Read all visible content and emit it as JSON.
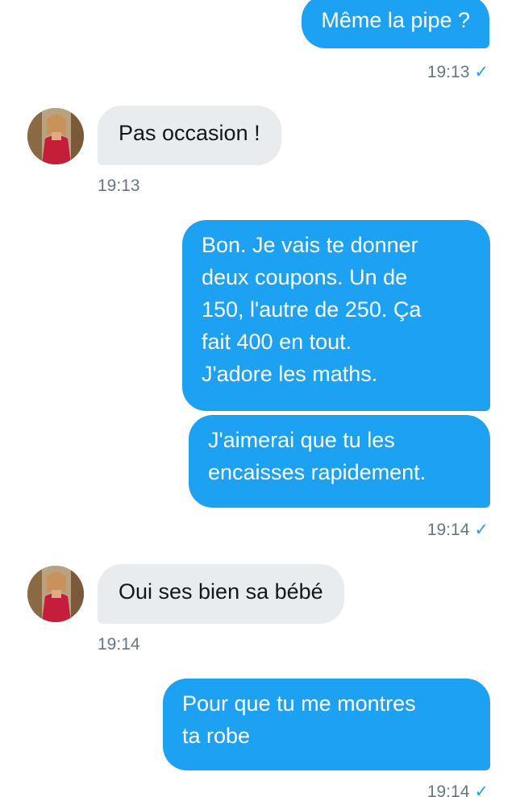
{
  "messages": [
    {
      "text": "Même la pipe ?",
      "time": "19:13"
    },
    {
      "text": "Pas occasion !",
      "time": "19:13"
    },
    {
      "lines": [
        "Bon. Je vais te donner",
        "deux coupons. Un de",
        "150, l'autre de 250. Ça",
        "fait 400 en tout.",
        "J'adore les maths."
      ]
    },
    {
      "lines": [
        "J'aimerai que tu les",
        "encaisses rapidement."
      ],
      "time": "19:14"
    },
    {
      "text": "Oui ses bien sa bébé",
      "time": "19:14"
    },
    {
      "lines": [
        "Pour que tu me montres",
        "ta robe"
      ],
      "time": "19:14"
    }
  ],
  "icons": {
    "read_receipt": "checkmark-icon",
    "avatar": "contact-avatar"
  },
  "colors": {
    "outgoing_bubble": "#1da1f2",
    "incoming_bubble": "#e8ecef",
    "timestamp": "#657786"
  }
}
